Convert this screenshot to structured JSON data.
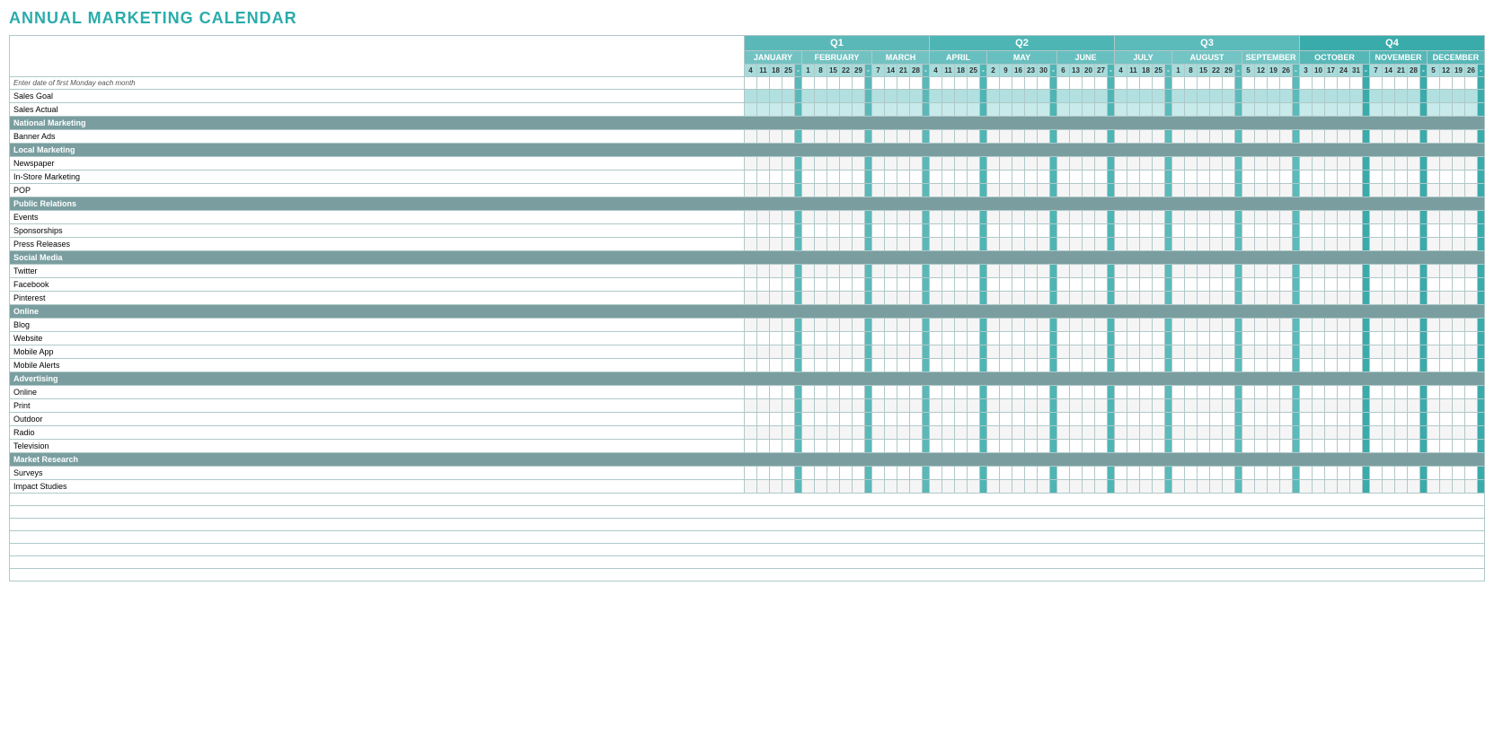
{
  "title": "ANNUAL MARKETING CALENDAR",
  "quarters": [
    {
      "label": "Q1",
      "months": [
        {
          "label": "JANUARY",
          "days": [
            4,
            11,
            18,
            25
          ]
        },
        {
          "label": "FEBRUARY",
          "days": [
            1,
            8,
            15,
            22,
            29
          ]
        },
        {
          "label": "MARCH",
          "days": [
            7,
            14,
            21,
            28
          ]
        }
      ]
    },
    {
      "label": "Q2",
      "months": [
        {
          "label": "APRIL",
          "days": [
            4,
            11,
            18,
            25
          ]
        },
        {
          "label": "MAY",
          "days": [
            2,
            9,
            16,
            23,
            30
          ]
        },
        {
          "label": "JUNE",
          "days": [
            6,
            13,
            20,
            27
          ]
        }
      ]
    },
    {
      "label": "Q3",
      "months": [
        {
          "label": "JULY",
          "days": [
            4,
            11,
            18,
            25
          ]
        },
        {
          "label": "AUGUST",
          "days": [
            1,
            8,
            15,
            22,
            29
          ]
        },
        {
          "label": "SEPTEMBER",
          "days": [
            5,
            12,
            19,
            26
          ]
        }
      ]
    },
    {
      "label": "Q4",
      "months": [
        {
          "label": "OCTOBER",
          "days": [
            3,
            10,
            17,
            24,
            31
          ]
        },
        {
          "label": "NOVEMBER",
          "days": [
            7,
            14,
            21,
            28
          ]
        },
        {
          "label": "DECEMBER",
          "days": [
            5,
            12,
            19,
            26
          ]
        }
      ]
    }
  ],
  "instruction": "Enter date of first Monday each month",
  "rows": [
    {
      "type": "sales",
      "label": "Sales Goal",
      "class": "sales-goal-row"
    },
    {
      "type": "sales",
      "label": "Sales Actual",
      "class": "sales-actual-row"
    },
    {
      "type": "category",
      "label": "National Marketing"
    },
    {
      "type": "item",
      "label": "Banner Ads"
    },
    {
      "type": "category",
      "label": "Local Marketing"
    },
    {
      "type": "item",
      "label": "Newspaper"
    },
    {
      "type": "item",
      "label": "In-Store Marketing"
    },
    {
      "type": "item",
      "label": "POP"
    },
    {
      "type": "category",
      "label": "Public Relations"
    },
    {
      "type": "item",
      "label": "Events"
    },
    {
      "type": "item",
      "label": "Sponsorships"
    },
    {
      "type": "item",
      "label": "Press Releases"
    },
    {
      "type": "category",
      "label": "Social Media"
    },
    {
      "type": "item",
      "label": "Twitter"
    },
    {
      "type": "item",
      "label": "Facebook"
    },
    {
      "type": "item",
      "label": "Pinterest"
    },
    {
      "type": "category",
      "label": "Online"
    },
    {
      "type": "item",
      "label": "Blog"
    },
    {
      "type": "item",
      "label": "Website"
    },
    {
      "type": "item",
      "label": "Mobile App"
    },
    {
      "type": "item",
      "label": "Mobile Alerts"
    },
    {
      "type": "category",
      "label": "Advertising"
    },
    {
      "type": "item",
      "label": "Online"
    },
    {
      "type": "item",
      "label": "Print"
    },
    {
      "type": "item",
      "label": "Outdoor"
    },
    {
      "type": "item",
      "label": "Radio"
    },
    {
      "type": "item",
      "label": "Television"
    },
    {
      "type": "category",
      "label": "Market Research"
    },
    {
      "type": "item",
      "label": "Surveys"
    },
    {
      "type": "item",
      "label": "Impact Studies"
    },
    {
      "type": "empty"
    },
    {
      "type": "empty"
    },
    {
      "type": "empty"
    },
    {
      "type": "empty"
    },
    {
      "type": "empty"
    },
    {
      "type": "empty"
    },
    {
      "type": "empty"
    }
  ]
}
